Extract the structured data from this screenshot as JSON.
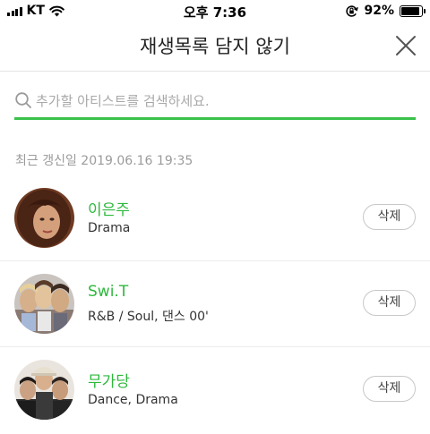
{
  "status_bar": {
    "carrier": "KT",
    "time": "오후 7:36",
    "battery_percent": "92%",
    "battery_level": 0.92
  },
  "header": {
    "title": "재생목록 담지 않기"
  },
  "search": {
    "placeholder": "추가할 아티스트를 검색하세요.",
    "value": "",
    "accent_color": "#39c24a"
  },
  "last_updated": "최근 갱신일 2019.06.16 19:35",
  "artists": [
    {
      "name": "이은주",
      "genre": "Drama",
      "delete_label": "삭제"
    },
    {
      "name": "Swi.T",
      "genre": "R&B / Soul, 댄스 00'",
      "delete_label": "삭제"
    },
    {
      "name": "무가당",
      "genre": "Dance, Drama",
      "delete_label": "삭제"
    }
  ],
  "colors": {
    "artist_name": "#2eb83c",
    "muted_text": "#9b9b9b"
  }
}
